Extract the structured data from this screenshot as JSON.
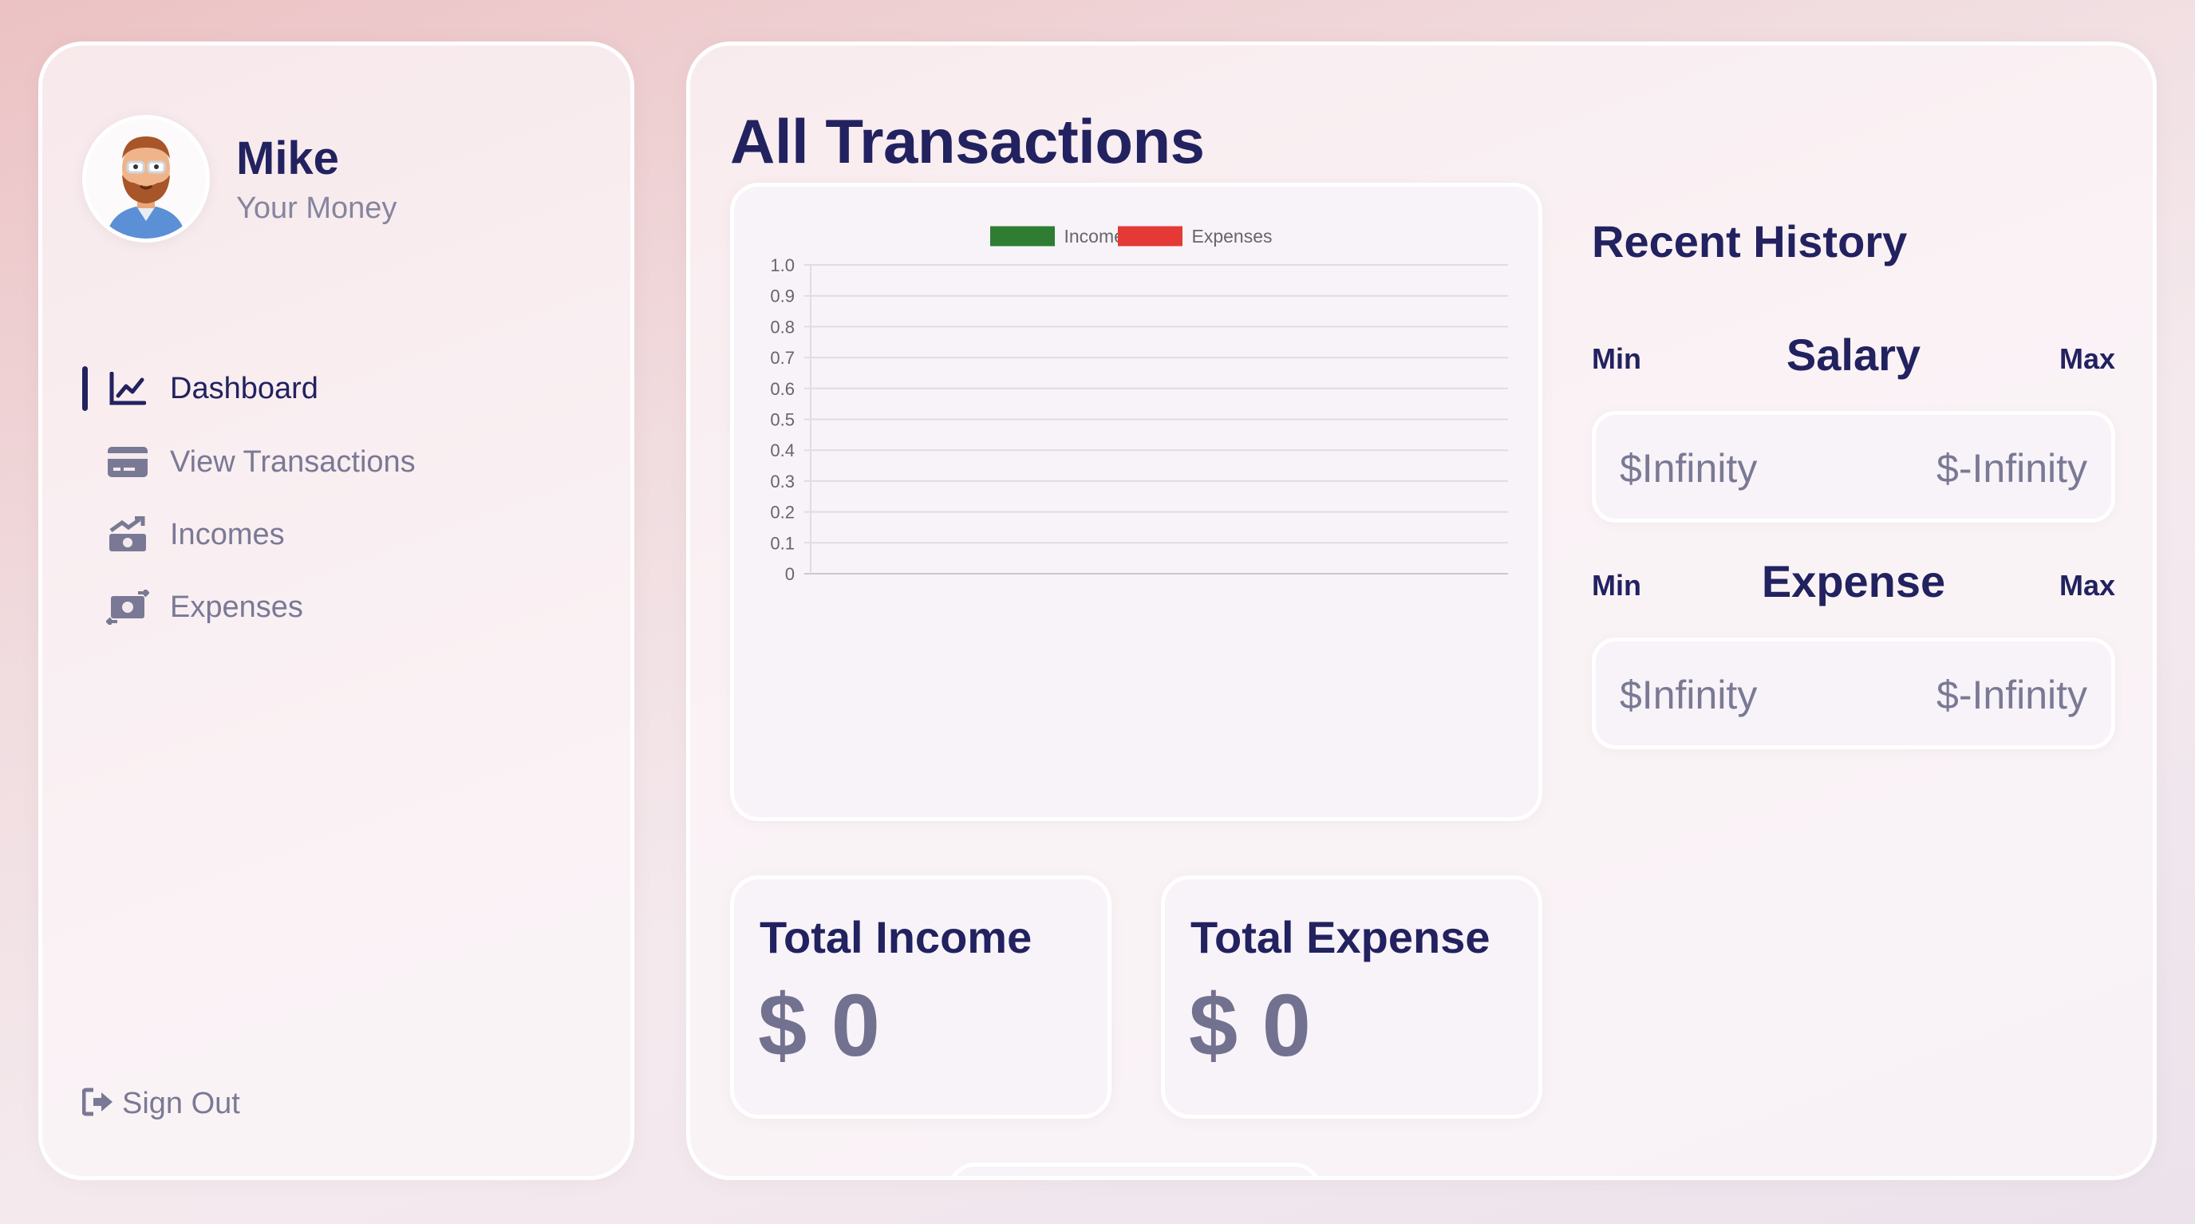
{
  "user": {
    "name": "Mike",
    "subtitle": "Your Money"
  },
  "nav": {
    "items": [
      {
        "label": "Dashboard",
        "icon": "chart-line-icon",
        "active": true
      },
      {
        "label": "View Transactions",
        "icon": "credit-card-icon",
        "active": false
      },
      {
        "label": "Incomes",
        "icon": "money-bill-trend-up-icon",
        "active": false
      },
      {
        "label": "Expenses",
        "icon": "money-bill-transfer-icon",
        "active": false
      }
    ],
    "signout": "Sign Out"
  },
  "page": {
    "title": "All Transactions"
  },
  "chart_data": {
    "type": "line",
    "series": [
      {
        "name": "Income",
        "color": "#2e7d32",
        "values": []
      },
      {
        "name": "Expenses",
        "color": "#e53935",
        "values": []
      }
    ],
    "ylim": [
      0,
      1.0
    ],
    "yticks": [
      "1.0",
      "0.9",
      "0.8",
      "0.7",
      "0.6",
      "0.5",
      "0.4",
      "0.3",
      "0.2",
      "0.1",
      "0"
    ],
    "grid": true,
    "legend": "top"
  },
  "totals": {
    "income": {
      "title": "Total Income",
      "value": "$ 0"
    },
    "expense": {
      "title": "Total Expense",
      "value": "$ 0"
    }
  },
  "history": {
    "title": "Recent History",
    "salary": {
      "min_label": "Min",
      "category": "Salary",
      "max_label": "Max",
      "min_value": "$Infinity",
      "max_value": "$-Infinity"
    },
    "expense": {
      "min_label": "Min",
      "category": "Expense",
      "max_label": "Max",
      "min_value": "$Infinity",
      "max_value": "$-Infinity"
    }
  },
  "colors": {
    "primary": "#222260",
    "muted": "#7a7995",
    "income": "#2e7d32",
    "expense": "#e53935"
  }
}
